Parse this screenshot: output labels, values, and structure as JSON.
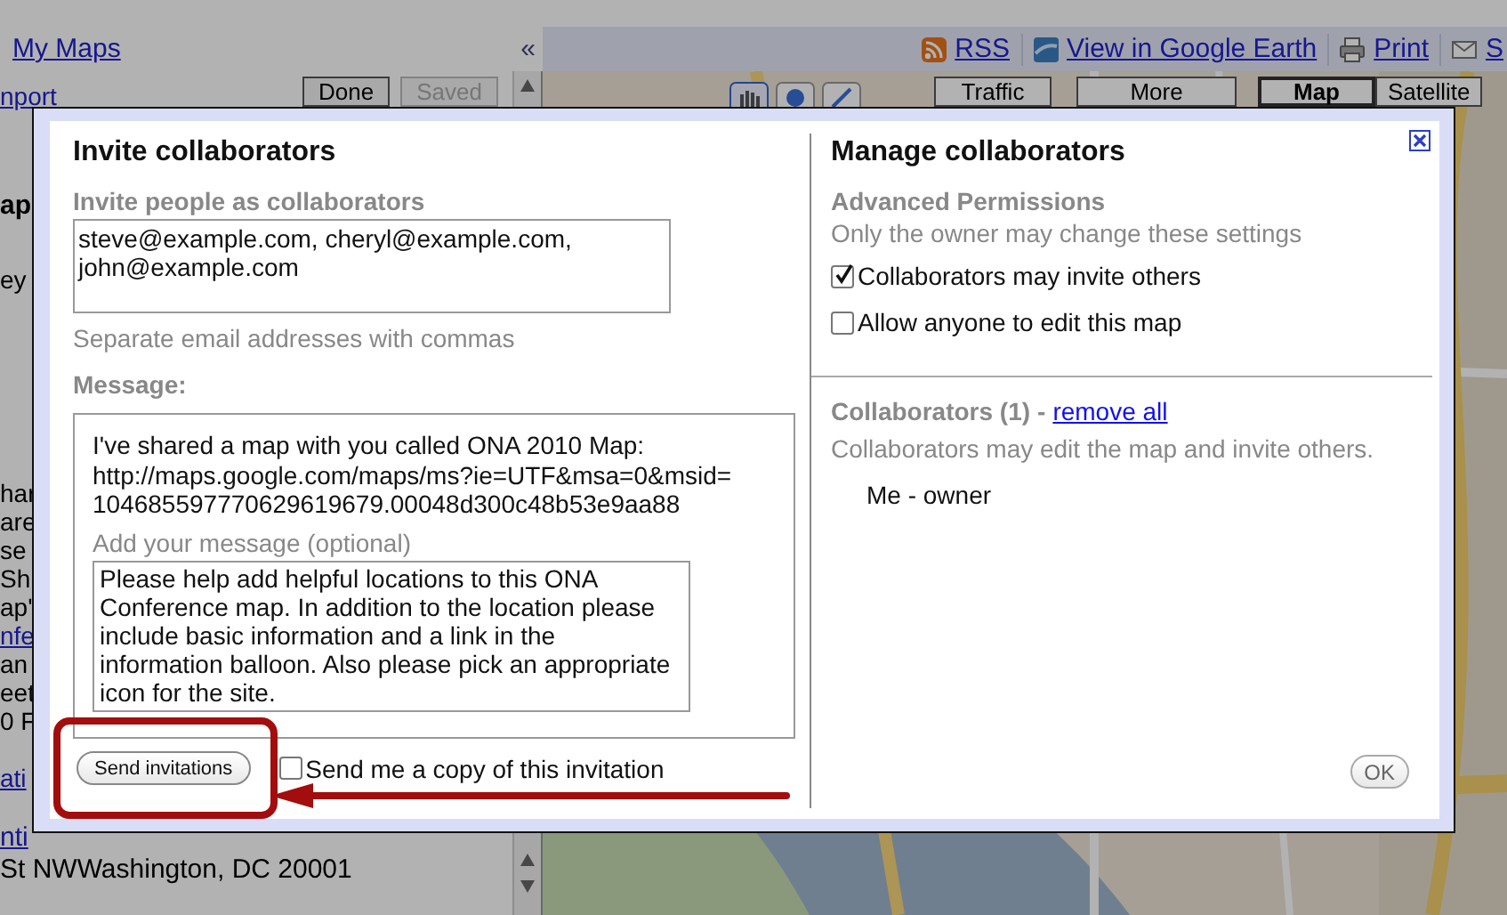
{
  "page": {
    "top_bar": {
      "my_maps_link": "My Maps",
      "collapse_button": "«",
      "links": [
        {
          "kind": "rss",
          "label": "RSS"
        },
        {
          "kind": "earth",
          "label": "View in Google Earth"
        },
        {
          "kind": "print",
          "label": "Print"
        },
        {
          "kind": "mail",
          "label": "S"
        }
      ]
    },
    "left_panel": {
      "import_link": "nport",
      "buttons": [
        {
          "label": "Done",
          "disabled": false
        },
        {
          "label": "Saved",
          "disabled": true
        }
      ],
      "blocks": [
        [
          {
            "kind": "heading",
            "text": "ap"
          }
        ],
        [
          {
            "kind": "text",
            "text": "ey"
          }
        ],
        [
          {
            "kind": "text",
            "text": "har"
          },
          {
            "kind": "text",
            "text": "are"
          },
          {
            "kind": "text",
            "text": "se"
          },
          {
            "kind": "text",
            "text": "Sh"
          },
          {
            "kind": "text",
            "text": "ap'"
          }
        ],
        [
          {
            "kind": "link",
            "text": "nfe"
          },
          {
            "kind": "text",
            "text": "an"
          },
          {
            "kind": "text",
            "text": "eet"
          },
          {
            "kind": "text",
            "text": "0 F"
          }
        ],
        [
          {
            "kind": "link",
            "text": "ati"
          }
        ],
        [
          {
            "kind": "link",
            "text": "nti"
          },
          {
            "kind": "text",
            "text": "St NWWashington, DC 20001"
          }
        ]
      ]
    },
    "map": {
      "kind": "picture",
      "buttons": [
        {
          "label": "Traffic",
          "selected": false
        },
        {
          "label": "More",
          "selected": false
        },
        {
          "label": "Map",
          "selected": true
        },
        {
          "label": "Satellite",
          "selected": false
        }
      ]
    }
  },
  "dialog": {
    "invite": {
      "title": "Invite collaborators",
      "emails_label": "Invite people as collaborators",
      "emails_value": "steve@example.com, cheryl@example.com, john@example.com",
      "emails_hint": "Separate email addresses with commas",
      "message_label": "Message:",
      "shared_text": [
        "I've shared a map with you called ONA 2010 Map:",
        "http://maps.google.com/maps/ms?ie=UTF&msa=0&msid=",
        "104685597770629619679.00048d300c48b53e9aa88"
      ],
      "optional_label": "Add your message (optional)",
      "message_value": "Please help add helpful locations to this ONA Conference map. In addition to the location please include basic information and a link in the information balloon. Also please pick an appropriate icon for the site.",
      "send_button": "Send invitations",
      "copy_option": {
        "label": "Send me a copy of this invitation",
        "checked": false
      }
    },
    "manage": {
      "title": "Manage collaborators",
      "permissions_heading": "Advanced Permissions",
      "permissions_note": "Only the owner may change these settings",
      "options": [
        {
          "label": "Collaborators may invite others",
          "checked": true
        },
        {
          "label": "Allow anyone to edit this map",
          "checked": false
        }
      ],
      "collaborators_heading": "Collaborators (1)",
      "separator": "-",
      "remove_all_link": "remove all",
      "collaborators_note": "Collaborators may edit the map and invite others.",
      "members": [
        "Me - owner"
      ],
      "ok_button": "OK"
    }
  }
}
